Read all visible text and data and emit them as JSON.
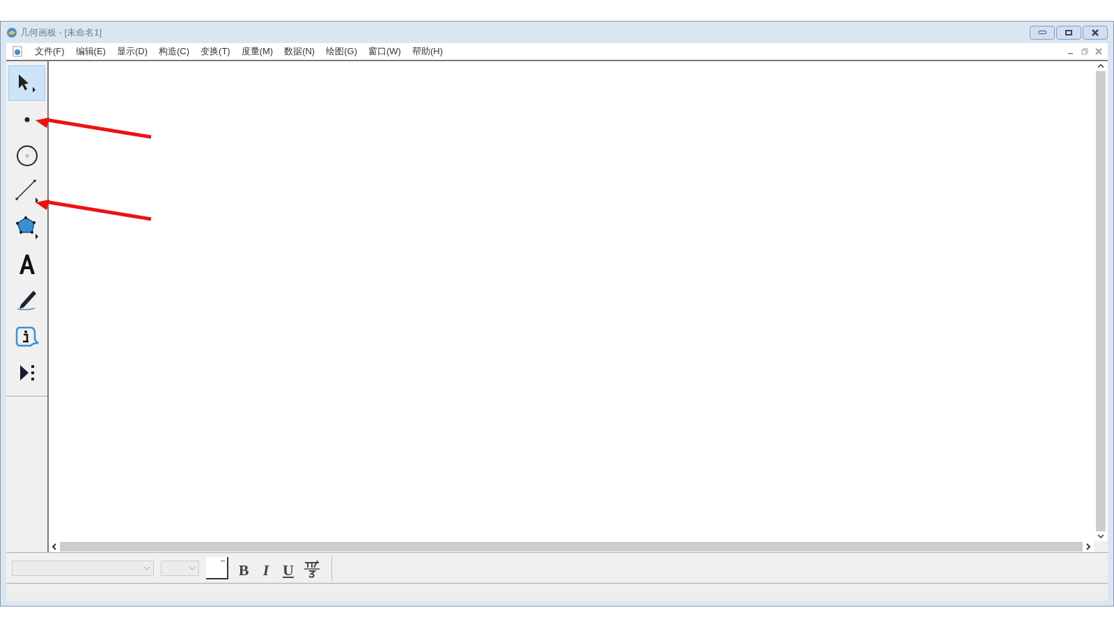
{
  "window": {
    "title": "几何画板 - [未命名1]"
  },
  "menu": [
    {
      "label": "文件(F)"
    },
    {
      "label": "编辑(E)"
    },
    {
      "label": "显示(D)"
    },
    {
      "label": "构造(C)"
    },
    {
      "label": "变换(T)"
    },
    {
      "label": "度量(M)"
    },
    {
      "label": "数据(N)"
    },
    {
      "label": "绘图(G)"
    },
    {
      "label": "窗口(W)"
    },
    {
      "label": "帮助(H)"
    }
  ],
  "tools": [
    {
      "kind": "select",
      "selected": true
    },
    {
      "kind": "point",
      "selected": false
    },
    {
      "kind": "compass",
      "selected": false
    },
    {
      "kind": "straightedge",
      "selected": false
    },
    {
      "kind": "polygon",
      "selected": false
    },
    {
      "kind": "text",
      "selected": false
    },
    {
      "kind": "marker",
      "selected": false
    },
    {
      "kind": "info",
      "selected": false
    },
    {
      "kind": "custom",
      "selected": false
    }
  ],
  "format_buttons": [
    {
      "kind": "bold",
      "label": "B"
    },
    {
      "kind": "italic",
      "label": "I"
    },
    {
      "kind": "underline",
      "label": "U"
    }
  ],
  "annotations": [
    {
      "kind": "arrow"
    },
    {
      "kind": "arrow"
    }
  ]
}
